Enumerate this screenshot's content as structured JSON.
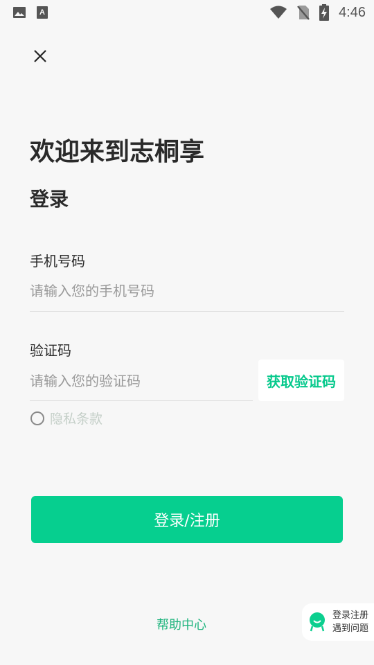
{
  "status_bar": {
    "time": "4:46",
    "icons": [
      "image-icon",
      "keyboard-icon",
      "wifi-icon",
      "no-sim-icon",
      "battery-charging-icon"
    ]
  },
  "header": {
    "close_icon": "close-icon"
  },
  "welcome": "欢迎来到志桐享",
  "login_title": "登录",
  "phone": {
    "label": "手机号码",
    "placeholder": "请输入您的手机号码",
    "value": ""
  },
  "code": {
    "label": "验证码",
    "placeholder": "请输入您的验证码",
    "value": "",
    "get_code_label": "获取验证码"
  },
  "privacy": {
    "label": "隐私条款",
    "checked": false
  },
  "submit_label": "登录/注册",
  "help_link": "帮助中心",
  "float_help": {
    "line1": "登录注册",
    "line2": "遇到问题",
    "icon": "chat-smile-icon"
  },
  "colors": {
    "accent": "#06cf8f",
    "accent_text": "#06c98c",
    "background": "#f7f7f7"
  }
}
